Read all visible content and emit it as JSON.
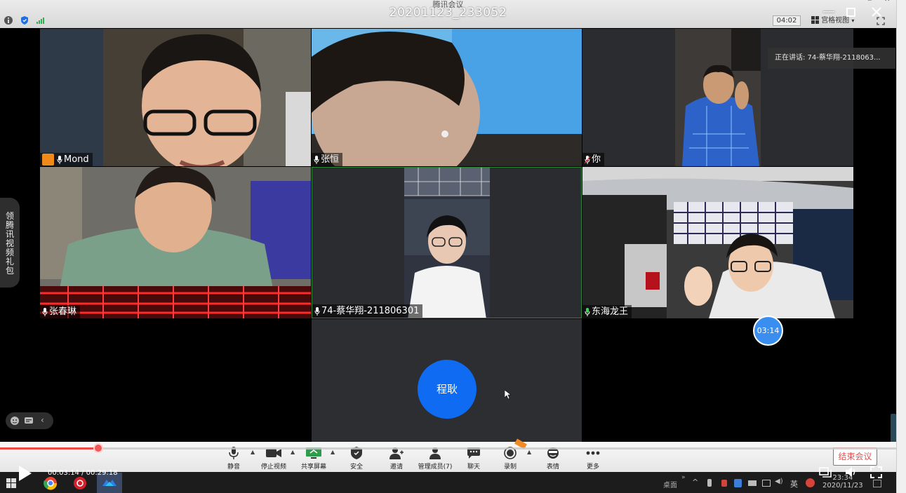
{
  "window": {
    "app_title": "腾讯会议",
    "recording_title": "20201123_233052",
    "meeting_timer": "04:02",
    "view_mode": "宫格视图"
  },
  "participants": [
    {
      "name": "Mond",
      "host": true
    },
    {
      "name": "张恒",
      "host": false
    },
    {
      "name": "你",
      "host": false
    },
    {
      "name": "张春琳",
      "host": false
    },
    {
      "name": "74-蔡华翔-211806301",
      "host": false
    },
    {
      "name": "东海龙王",
      "host": false
    },
    {
      "name": "程耿",
      "host": false
    }
  ],
  "speaking": "正在讲话: 74-蔡华翔-2118063...",
  "side_tab": {
    "chars": [
      "领",
      "腾",
      "讯",
      "视",
      "频",
      "礼",
      "包"
    ]
  },
  "timer_bubble": "03:14",
  "toolbar": {
    "items": [
      {
        "label": "静音",
        "icon": "microphone-icon"
      },
      {
        "label": "停止视频",
        "icon": "camera-icon"
      },
      {
        "label": "共享屏幕",
        "icon": "share-screen-icon"
      },
      {
        "label": "安全",
        "icon": "shield-icon"
      },
      {
        "label": "邀请",
        "icon": "invite-icon"
      },
      {
        "label": "管理成员(7)",
        "icon": "members-icon"
      },
      {
        "label": "聊天",
        "icon": "chat-icon"
      },
      {
        "label": "录制",
        "icon": "record-icon"
      },
      {
        "label": "表情",
        "icon": "emoji-icon"
      },
      {
        "label": "更多",
        "icon": "more-icon"
      }
    ],
    "end_label": "结束会议"
  },
  "player": {
    "current_time": "00:03:14",
    "duration": "00:29:18",
    "time_display": "00:03:14 / 00:29:18",
    "progress": 0.11
  },
  "taskbar": {
    "desktop_label": "桌面",
    "ime_label": "英",
    "clock_time": "23:34",
    "clock_date": "2020/11/23"
  },
  "colors": {
    "accent_blue": "#0f6cf2",
    "end_red": "#e05252",
    "progress_red": "#f04848",
    "host_orange": "#f28a1a"
  }
}
